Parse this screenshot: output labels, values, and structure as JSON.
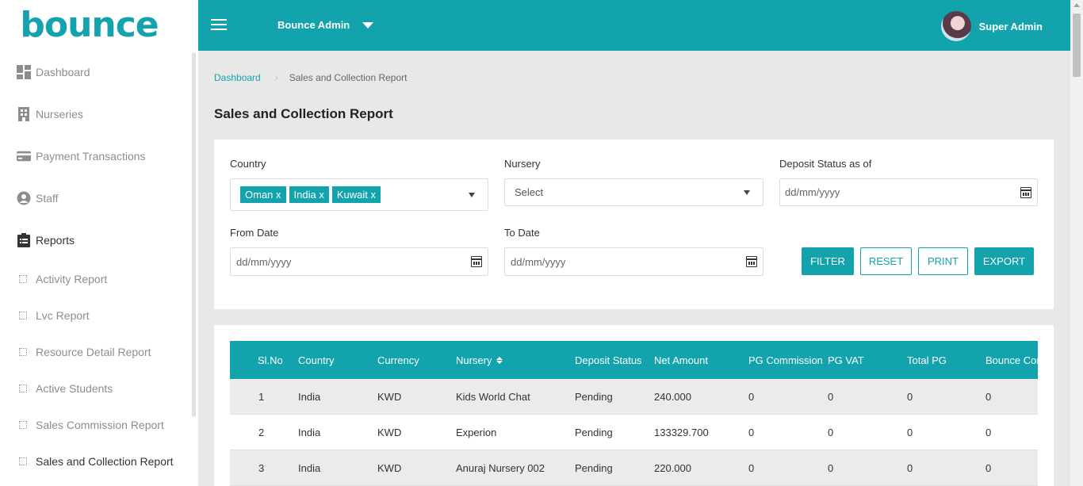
{
  "app": {
    "logo_text": "bounce",
    "brand_color": "#13a3ad",
    "accent_color": "#f3c417"
  },
  "header": {
    "admin_select": "Bounce Admin",
    "user_name": "Super Admin"
  },
  "sidebar": {
    "items": [
      {
        "label": "Dashboard",
        "icon": "dashboard-icon"
      },
      {
        "label": "Nurseries",
        "icon": "building-icon"
      },
      {
        "label": "Payment Transactions",
        "icon": "credit-card-icon"
      },
      {
        "label": "Staff",
        "icon": "user-icon"
      },
      {
        "label": "Reports",
        "icon": "clipboard-icon"
      }
    ],
    "report_items": [
      "Activity Report",
      "Lvc Report",
      "Resource Detail Report",
      "Active Students",
      "Sales Commission Report",
      "Sales and Collection Report"
    ]
  },
  "breadcrumb": {
    "home": "Dashboard",
    "current": "Sales and Collection Report"
  },
  "page_title": "Sales and Collection Report",
  "filters": {
    "country_label": "Country",
    "country_tags": [
      "Oman x",
      "India x",
      "Kuwait x"
    ],
    "nursery_label": "Nursery",
    "nursery_value": "Select",
    "deposit_label": "Deposit Status as of",
    "deposit_placeholder": "dd/mm/yyyy",
    "from_label": "From Date",
    "from_placeholder": "dd/mm/yyyy",
    "to_label": "To Date",
    "to_placeholder": "dd/mm/yyyy",
    "buttons": {
      "filter": "FILTER",
      "reset": "RESET",
      "print": "PRINT",
      "export": "EXPORT"
    }
  },
  "table": {
    "headers": [
      "Sl.No",
      "Country",
      "Currency",
      "Nursery",
      "Deposit Status",
      "Net Amount",
      "PG Commission",
      "PG VAT",
      "Total PG",
      "Bounce Com"
    ],
    "rows": [
      [
        "1",
        "India",
        "KWD",
        "Kids World Chat",
        "Pending",
        "240.000",
        "0",
        "0",
        "0",
        "0"
      ],
      [
        "2",
        "India",
        "KWD",
        "Experion",
        "Pending",
        "133329.700",
        "0",
        "0",
        "0",
        "0"
      ],
      [
        "3",
        "India",
        "KWD",
        "Anuraj Nursery 002",
        "Pending",
        "220.000",
        "0",
        "0",
        "0",
        "0"
      ]
    ]
  }
}
